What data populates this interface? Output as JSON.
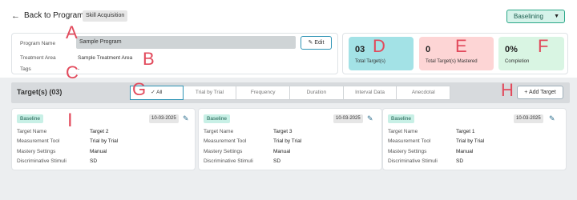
{
  "header": {
    "back_label": "Back to Program",
    "skill_chip": "Skill Acquisition",
    "status_select": "Baselining"
  },
  "program": {
    "name_label": "Program Name",
    "name_value": "Sample Program",
    "area_label": "Treatment Area",
    "area_value": "Sample Treatment Area",
    "tags_label": "Tags",
    "tags_value": "-",
    "edit_label": "Edit"
  },
  "stats": [
    {
      "value": "03",
      "label": "Total Target(s)",
      "color": "#a3e2e6"
    },
    {
      "value": "0",
      "label": "Total Target(s) Mastered",
      "color": "#fdd5d5"
    },
    {
      "value": "0%",
      "label": "Completion",
      "color": "#d9f5e3"
    }
  ],
  "annotations": [
    "A",
    "B",
    "C",
    "D",
    "E",
    "F",
    "G",
    "H",
    "I"
  ],
  "targets": {
    "title": "Target(s) (03)",
    "add_label": "Add Target",
    "tabs": [
      "✓ All",
      "Trial by Trial",
      "Frequency",
      "Duration",
      "Interval Data",
      "Anecdotal"
    ],
    "field_labels": [
      "Target Name",
      "Measurement Tool",
      "Mastery Settings",
      "Discriminative Stimuli"
    ],
    "cards": [
      {
        "badge": "Baseline",
        "date": "10-03-2025",
        "values": [
          "Target 2",
          "Trial by Trial",
          "Manual",
          "SD"
        ]
      },
      {
        "badge": "Baseline",
        "date": "10-03-2025",
        "values": [
          "Target 3",
          "Trial by Trial",
          "Manual",
          "SD"
        ]
      },
      {
        "badge": "Baseline",
        "date": "10-03-2025",
        "values": [
          "Target 1",
          "Trial by Trial",
          "Manual",
          "SD"
        ]
      }
    ]
  },
  "colors": {
    "accent": "#2e94b5",
    "annotation": "#e24a5c",
    "badge_bg": "#c8f0e6"
  }
}
